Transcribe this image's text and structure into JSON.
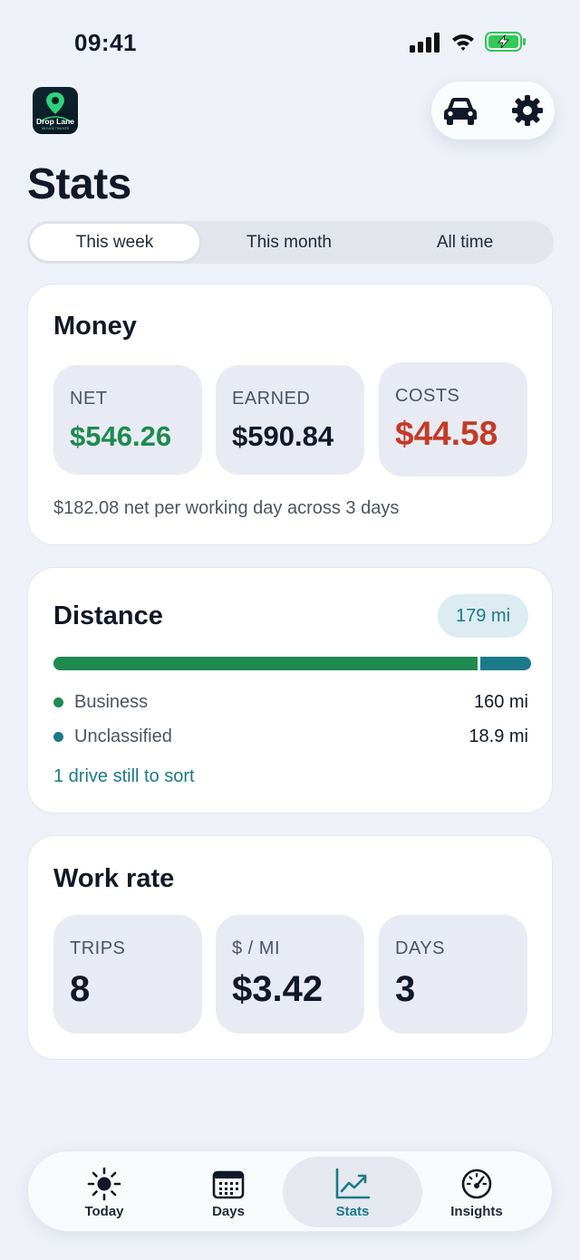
{
  "status_bar": {
    "time": "09:41"
  },
  "app": {
    "logo_text": "Drop Lane",
    "logo_subtext": "MILEAGE TRACKER"
  },
  "header": {
    "title": "Stats"
  },
  "period_tabs": [
    {
      "label": "This week",
      "active": true
    },
    {
      "label": "This month",
      "active": false
    },
    {
      "label": "All time",
      "active": false
    }
  ],
  "money": {
    "title": "Money",
    "net": {
      "label": "NET",
      "value": "$546.26"
    },
    "earned": {
      "label": "EARNED",
      "value": "$590.84"
    },
    "costs": {
      "label": "COSTS",
      "value": "$44.58"
    },
    "footnote": "$182.08 net per working day across 3 days"
  },
  "distance": {
    "title": "Distance",
    "total": "179 mi",
    "business_fraction": 0.894,
    "rows": [
      {
        "label": "Business",
        "value": "160 mi",
        "color": "#1e8a4f"
      },
      {
        "label": "Unclassified",
        "value": "18.9 mi",
        "color": "#1b7a8a"
      }
    ],
    "sort_link": "1 drive still to sort"
  },
  "work_rate": {
    "title": "Work rate",
    "trips": {
      "label": "TRIPS",
      "value": "8"
    },
    "per_mile": {
      "label": "$ / MI",
      "value": "$3.42"
    },
    "days": {
      "label": "DAYS",
      "value": "3"
    }
  },
  "nav": [
    {
      "label": "Today",
      "icon": "sun-icon",
      "active": false
    },
    {
      "label": "Days",
      "icon": "calendar-icon",
      "active": false
    },
    {
      "label": "Stats",
      "icon": "chart-icon",
      "active": true
    },
    {
      "label": "Insights",
      "icon": "speedometer-icon",
      "active": false
    }
  ],
  "colors": {
    "accent": "#1b7a8a",
    "positive": "#1e8a4f",
    "negative": "#c43b27"
  }
}
